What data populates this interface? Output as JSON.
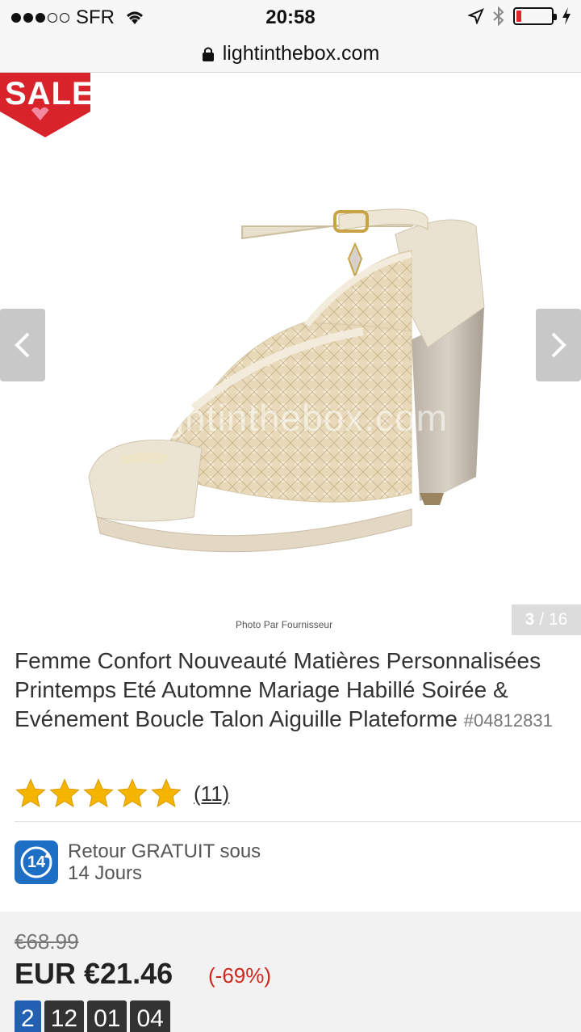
{
  "status_bar": {
    "carrier": "SFR",
    "time": "20:58",
    "battery_level": 0.15,
    "battery_color": "#e0262a"
  },
  "url_bar": {
    "domain": "lightinthebox.com"
  },
  "gallery": {
    "sale_label": "SALE",
    "watermark": "lightinthebox.com",
    "photo_credit": "Photo Par Fournisseur",
    "current_image": "3",
    "total_images": "/ 16",
    "prev_icon": "chevron-left-icon",
    "next_icon": "chevron-right-icon"
  },
  "product": {
    "title": "Femme Confort Nouveauté Matières Personnalisées Printemps Eté Automne Mariage Habillé Soirée & Evénement Boucle Talon Aiguille Plateforme",
    "sku": "#04812831",
    "rating": 5,
    "review_count": "(11)"
  },
  "return_policy": {
    "badge_number": "14",
    "line1": "Retour GRATUIT sous",
    "line2": "14 Jours"
  },
  "pricing": {
    "old_price": "€68.99",
    "new_price": "EUR €21.46",
    "discount": "(-69%)",
    "countdown": [
      "2",
      "12",
      "01",
      "04"
    ]
  },
  "colors": {
    "accent_red": "#d0271d",
    "badge_blue": "#1c6fc4",
    "sale_red": "#d8232a",
    "star_gold": "#f5b400"
  }
}
